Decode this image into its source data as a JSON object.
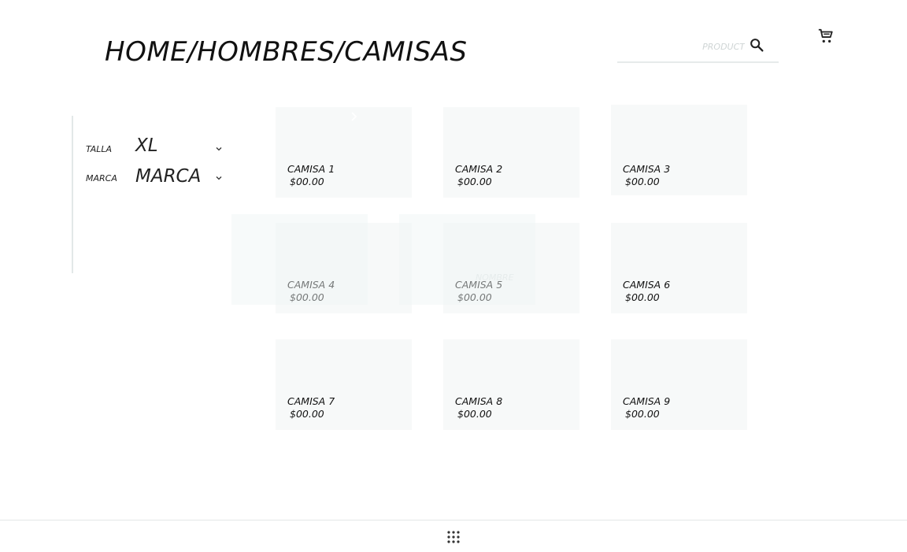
{
  "header": {
    "breadcrumb": "HOME/HOMBRES/CAMISAS"
  },
  "search": {
    "placeholder": "PRODUCT",
    "icon": "search-icon"
  },
  "cart": {
    "icon": "cart-icon"
  },
  "filters": [
    {
      "label": "TALLA",
      "value": "XL"
    },
    {
      "label": "MARCA",
      "value": "MARCA"
    }
  ],
  "products": [
    {
      "name": "CAMISA 1",
      "price": "$00.00"
    },
    {
      "name": "CAMISA 2",
      "price": "$00.00"
    },
    {
      "name": "CAMISA 3",
      "price": "$00.00"
    },
    {
      "name": "CAMISA 4",
      "price": "$00.00"
    },
    {
      "name": "CAMISA 5",
      "price": "$00.00"
    },
    {
      "name": "CAMISA 6",
      "price": "$00.00"
    },
    {
      "name": "CAMISA 7",
      "price": "$00.00"
    },
    {
      "name": "CAMISA 8",
      "price": "$00.00"
    },
    {
      "name": "CAMISA 9",
      "price": "$00.00"
    }
  ],
  "overlay": {
    "label": "NOMBRE"
  },
  "colors": {
    "card_bg": "#f7f9f9",
    "text": "#111111",
    "divider": "#e3e8e8"
  }
}
